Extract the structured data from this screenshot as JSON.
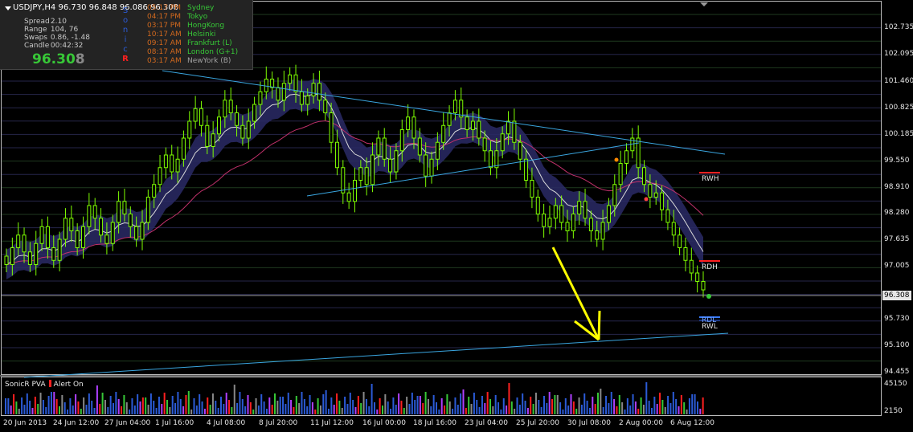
{
  "chart_title": "USDJPY,H4  96.730 96.848 96.086 96.308",
  "info_panel": {
    "stats": [
      {
        "label": "Spread",
        "value": "2.10"
      },
      {
        "label": "Range",
        "value": "104, 76"
      },
      {
        "label": "Swaps",
        "value": "0.86, -1.48"
      },
      {
        "label": "Candle",
        "value": "00:42:32"
      }
    ],
    "big_price_main": "96.30",
    "big_price_last": "8",
    "brand_letters": [
      "S",
      "o",
      "n",
      "i",
      "c",
      "R"
    ],
    "brand_colors": [
      "#2b5bd7",
      "#2b5bd7",
      "#2b5bd7",
      "#2b5bd7",
      "#2b5bd7",
      "#ff2020"
    ],
    "sessions": [
      {
        "time": "05:17 PM",
        "name": "Sydney"
      },
      {
        "time": "04:17 PM",
        "name": "Tokyo"
      },
      {
        "time": "03:17 PM",
        "name": "HongKong"
      },
      {
        "time": "10:17 AM",
        "name": "Helsinki"
      },
      {
        "time": "09:17 AM",
        "name": "Frankfurt  (L)"
      },
      {
        "time": "08:17 AM",
        "name": "London  (G+1)"
      },
      {
        "time": "03:17 AM",
        "name": "NewYork  (B)"
      }
    ]
  },
  "price_axis": [
    "102.735",
    "102.095",
    "101.460",
    "100.825",
    "100.185",
    "99.550",
    "98.910",
    "98.280",
    "97.635",
    "97.005",
    "96.308",
    "95.730",
    "95.100",
    "94.455"
  ],
  "current_price": "96.308",
  "time_axis": [
    "20 Jun 2013",
    "24 Jun 12:00",
    "27 Jun 04:00",
    "1 Jul 16:00",
    "4 Jul 08:00",
    "8 Jul 20:00",
    "11 Jul 12:00",
    "16 Jul 00:00",
    "18 Jul 16:00",
    "23 Jul 04:00",
    "25 Jul 20:00",
    "30 Jul 08:00",
    "2 Aug 00:00",
    "6 Aug 12:00"
  ],
  "level_labels": [
    "RWH",
    "RDH",
    "RDL",
    "RWL"
  ],
  "indicator": {
    "name": "SonicR PVA",
    "alert": "Alert On",
    "volume_axis": [
      "45150",
      "2150"
    ]
  },
  "chart_data": {
    "type": "candlestick",
    "symbol": "USDJPY",
    "timeframe": "H4",
    "open": 96.73,
    "high": 96.848,
    "low": 96.086,
    "close": 96.308,
    "ylim": [
      94.3,
      103.1
    ],
    "closes": [
      96.9,
      97.3,
      97.6,
      97.2,
      96.9,
      97.4,
      97.8,
      97.3,
      97.0,
      97.5,
      98.0,
      97.7,
      97.3,
      97.8,
      98.3,
      98.0,
      97.6,
      97.4,
      97.9,
      98.4,
      98.1,
      97.8,
      97.5,
      97.9,
      98.5,
      98.8,
      99.2,
      99.5,
      99.1,
      99.4,
      99.9,
      100.3,
      100.6,
      100.2,
      99.7,
      100.0,
      100.4,
      100.8,
      100.5,
      100.2,
      99.9,
      100.3,
      100.7,
      101.0,
      101.3,
      101.1,
      100.8,
      101.2,
      101.4,
      101.0,
      100.7,
      100.9,
      101.2,
      100.8,
      100.5,
      99.8,
      99.2,
      98.6,
      98.4,
      98.9,
      99.2,
      98.8,
      99.5,
      99.9,
      99.4,
      99.1,
      99.6,
      100.1,
      100.4,
      99.9,
      99.5,
      99.0,
      99.4,
      99.8,
      100.2,
      100.5,
      100.8,
      100.4,
      100.1,
      100.3,
      99.9,
      99.6,
      99.2,
      99.6,
      100.0,
      100.3,
      99.8,
      99.4,
      98.9,
      98.5,
      98.1,
      97.8,
      98.0,
      98.3,
      97.9,
      97.7,
      98.1,
      98.4,
      98.0,
      97.7,
      97.5,
      97.9,
      98.3,
      98.8,
      99.3,
      99.6,
      99.9,
      99.2,
      98.8,
      98.5,
      98.6,
      98.2,
      97.9,
      97.6,
      97.3,
      97.0,
      96.7,
      96.5,
      96.3
    ]
  }
}
